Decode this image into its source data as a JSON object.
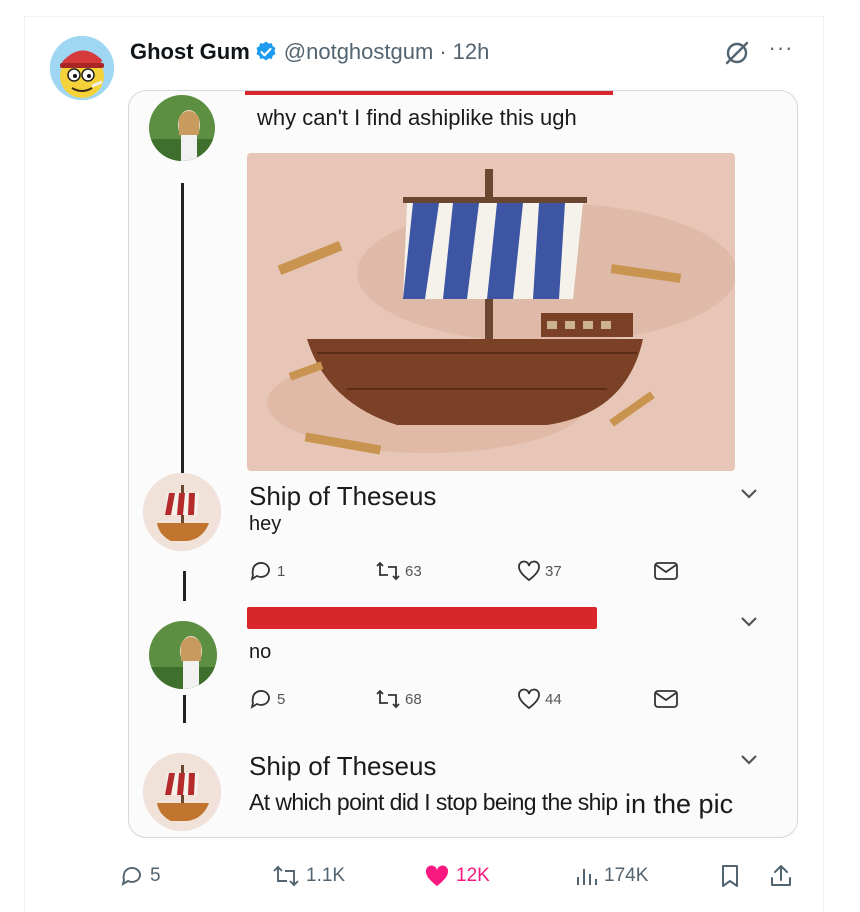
{
  "tweet": {
    "author_name": "Ghost Gum",
    "handle": "@notghostgum",
    "separator": "·",
    "time": "12h",
    "verified": true,
    "more_label": "···"
  },
  "media": {
    "top_post_text": "why can't I find ashiplike this ugh",
    "reply1": {
      "name": "Ship of Theseus",
      "text": "hey",
      "replies": "1",
      "retweets": "63",
      "likes": "37"
    },
    "reply2": {
      "text": "no",
      "replies": "5",
      "retweets": "68",
      "likes": "44"
    },
    "reply3": {
      "name": "Ship of Theseus",
      "text": "At which point did I stop being the ship",
      "text_tail": "in the pic"
    }
  },
  "actions": {
    "replies": "5",
    "retweets": "1.1K",
    "likes": "12K",
    "views": "174K",
    "liked": true
  },
  "icons": {
    "verified": "verified-badge-icon",
    "grok": "grok-icon",
    "more": "more-icon",
    "reply": "reply-icon",
    "retweet": "retweet-icon",
    "like": "heart-icon",
    "views": "views-icon",
    "bookmark": "bookmark-icon",
    "share": "share-icon"
  },
  "colors": {
    "verified": "#1d9bf0",
    "like_active": "#f91880",
    "secondary_text": "#536471",
    "red_bar": "#d8262a",
    "sail_blue": "#3d55a3",
    "hull_brown": "#7b4126"
  }
}
